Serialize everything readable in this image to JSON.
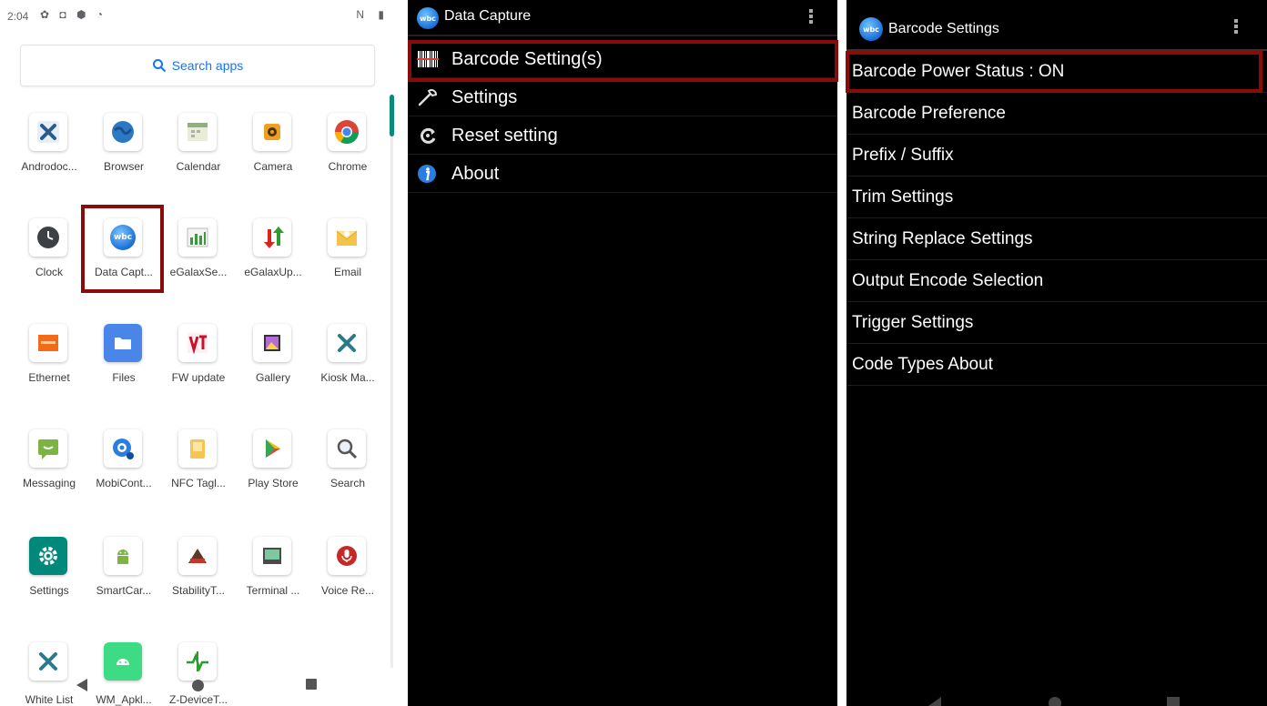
{
  "status_bar": {
    "time": "2:04",
    "left_icons": "✿ ◘ ⬢ ◔",
    "right_icons": "N ▮"
  },
  "search": {
    "label": "Search apps",
    "icon": "search-icon"
  },
  "apps": [
    {
      "label": "Androdoc...",
      "icon": "tools-icon"
    },
    {
      "label": "Browser",
      "icon": "globe-icon"
    },
    {
      "label": "Calendar",
      "icon": "calendar-icon"
    },
    {
      "label": "Camera",
      "icon": "camera-icon"
    },
    {
      "label": "Chrome",
      "icon": "chrome-icon"
    },
    {
      "label": "Clock",
      "icon": "clock-icon"
    },
    {
      "label": "Data Capt...",
      "icon": "wbc-icon"
    },
    {
      "label": "eGalaxSe...",
      "icon": "bar-chart-icon"
    },
    {
      "label": "eGalaxUp...",
      "icon": "updown-arrows-icon"
    },
    {
      "label": "Email",
      "icon": "envelope-icon"
    },
    {
      "label": "Ethernet",
      "icon": "ethernet-icon"
    },
    {
      "label": "Files",
      "icon": "folder-icon"
    },
    {
      "label": "FW update",
      "icon": "fw-update-icon"
    },
    {
      "label": "Gallery",
      "icon": "image-icon"
    },
    {
      "label": "Kiosk Ma...",
      "icon": "tools-icon"
    },
    {
      "label": "Messaging",
      "icon": "chat-icon"
    },
    {
      "label": "MobiCont...",
      "icon": "mobicontrol-icon"
    },
    {
      "label": "NFC Tagl...",
      "icon": "nfc-icon"
    },
    {
      "label": "Play Store",
      "icon": "play-store-icon"
    },
    {
      "label": "Search",
      "icon": "magnifier-icon"
    },
    {
      "label": "Settings",
      "icon": "gear-icon"
    },
    {
      "label": "SmartCar...",
      "icon": "android-icon"
    },
    {
      "label": "StabilityT...",
      "icon": "stability-icon"
    },
    {
      "label": "Terminal ...",
      "icon": "terminal-icon"
    },
    {
      "label": "Voice Re...",
      "icon": "microphone-icon"
    },
    {
      "label": "White List",
      "icon": "tools-icon"
    },
    {
      "label": "WM_Apkl...",
      "icon": "android-icon"
    },
    {
      "label": "Z-DeviceT...",
      "icon": "pulse-icon"
    }
  ],
  "data_capture": {
    "title": "Data Capture",
    "menu": [
      {
        "label": "Barcode Setting(s)",
        "icon": "barcode-icon"
      },
      {
        "label": "Settings",
        "icon": "wrench-icon"
      },
      {
        "label": "Reset setting",
        "icon": "reset-icon"
      },
      {
        "label": "About",
        "icon": "info-icon"
      }
    ]
  },
  "barcode_settings": {
    "title": "Barcode Settings",
    "items": [
      "Barcode Power Status : ON",
      "Barcode Preference",
      "Prefix / Suffix",
      "Trim Settings",
      "String Replace Settings",
      "Output Encode Selection",
      "Trigger Settings",
      "Code Types About"
    ]
  },
  "colors": {
    "highlight": "#8b0a0a",
    "accent": "#1a73e8",
    "scroll": "#0a8a7a"
  }
}
